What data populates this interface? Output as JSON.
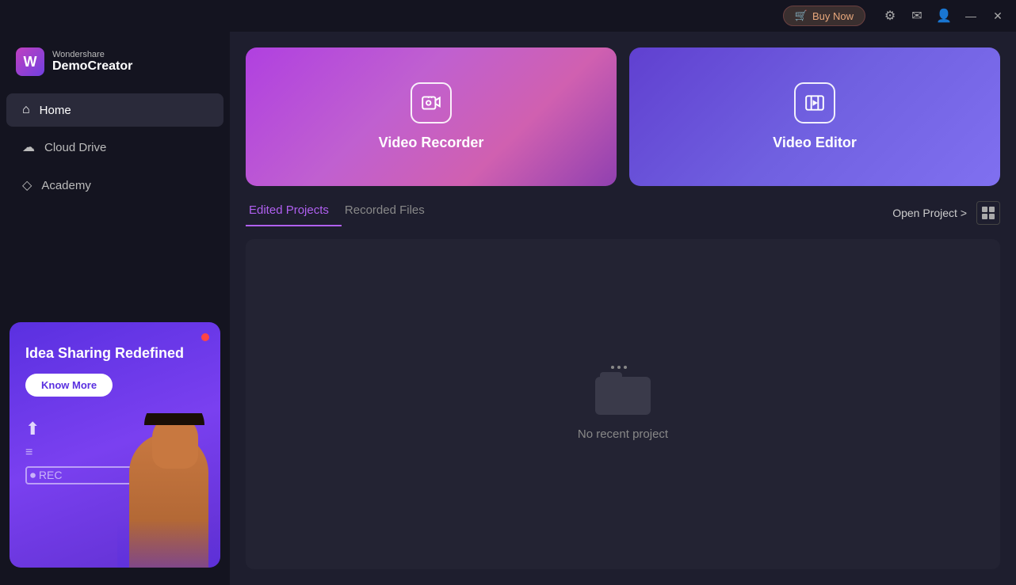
{
  "app": {
    "brand": "Wondershare",
    "product": "DemoCreator"
  },
  "titlebar": {
    "buy_now": "Buy Now",
    "minimize": "—",
    "close": "✕"
  },
  "sidebar": {
    "nav_items": [
      {
        "id": "home",
        "label": "Home",
        "icon": "⌂",
        "active": true
      },
      {
        "id": "cloud-drive",
        "label": "Cloud Drive",
        "icon": "☁",
        "active": false
      },
      {
        "id": "academy",
        "label": "Academy",
        "icon": "◇",
        "active": false
      }
    ],
    "promo": {
      "title": "Idea Sharing Redefined",
      "button_label": "Know More",
      "dot_color": "#ff4444"
    }
  },
  "hero_cards": [
    {
      "id": "video-recorder",
      "label": "Video Recorder",
      "icon": "🎬"
    },
    {
      "id": "video-editor",
      "label": "Video Editor",
      "icon": "🎞"
    }
  ],
  "tabs": {
    "items": [
      {
        "id": "edited-projects",
        "label": "Edited Projects",
        "active": true
      },
      {
        "id": "recorded-files",
        "label": "Recorded Files",
        "active": false
      }
    ],
    "open_project": "Open Project >",
    "grid_icon": "⊞"
  },
  "empty_state": {
    "message": "No recent project"
  }
}
